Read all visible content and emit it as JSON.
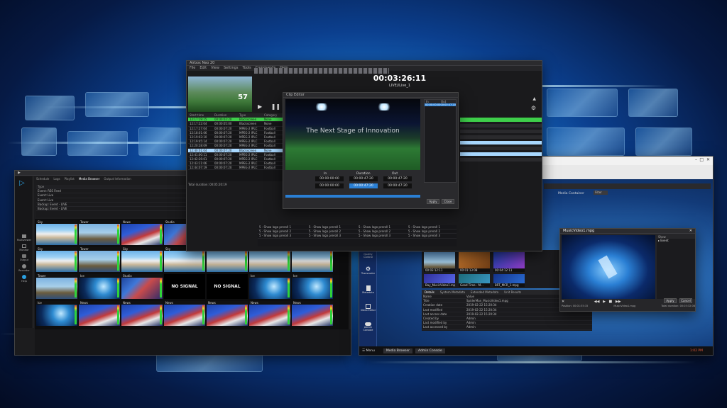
{
  "scheduler": {
    "title": "Airbox Neo 20",
    "menu": [
      "File",
      "Edit",
      "View",
      "Settings",
      "Tools",
      "Commands",
      "Help"
    ],
    "clock": "00:03:26:11",
    "channel": "LIVE//Live_1",
    "status_line": "Total duration: 00:05:20:19",
    "columns": [
      "Start time",
      "Duration",
      "Type",
      "Category"
    ],
    "rows": [
      [
        "12:17:19:15",
        "00:00:02:20",
        "Blackscreen",
        "None"
      ],
      [
        "12:17:22:04",
        "00:00:05:00",
        "Blackscreen",
        "None"
      ],
      [
        "12:17:27:04",
        "00:00:07:20",
        "MPEG-2 IPLC",
        "Football"
      ],
      [
        "12:18:01:06",
        "00:00:07:20",
        "MPEG-2 IPLC",
        "Football"
      ],
      [
        "12:19:03:10",
        "00:00:07:20",
        "MPEG-2 IPLC",
        "Football"
      ],
      [
        "12:19:45:14",
        "00:00:07:20",
        "MPEG-2 IPLC",
        "Football"
      ],
      [
        "12:20:28:09",
        "00:00:07:20",
        "MPEG-2 IPLC",
        "Football"
      ],
      [
        "12:40:01:04",
        "00:00:07:20",
        "Blackscreen",
        "None"
      ],
      [
        "12:41:00:11",
        "00:00:07:20",
        "MPEG-2 IPLC",
        "Football"
      ],
      [
        "12:42:26:01",
        "00:00:07:20",
        "MPEG-2 IPLC",
        "Football"
      ],
      [
        "12:43:11:06",
        "00:00:07:20",
        "MPEG-2 IPLC",
        "Football"
      ],
      [
        "12:44:07:19",
        "00:00:07:20",
        "MPEG-2 IPLC",
        "Football"
      ]
    ],
    "logo_rows": [
      [
        "5 - Show logo preroll 1",
        "5 - Show logo preroll 1",
        "5 - Show logo preroll 1",
        "5 - Show logo preroll 1"
      ],
      [
        "5 - Show logo preroll 2",
        "5 - Show logo preroll 2",
        "5 - Show logo preroll 2",
        "5 - Show logo preroll 2"
      ],
      [
        "5 - Show logo preroll 3",
        "5 - Show logo preroll 3",
        "5 - Show logo preroll 3",
        "5 - Show logo preroll 3"
      ]
    ]
  },
  "clip_editor": {
    "title": "Clip Editor",
    "overlay_text": "The Next Stage of Innovation",
    "tc_in": "00:00:00:00",
    "tc_duration": "00:00:47:20",
    "tc_out": "00:00:47:20",
    "tc_in2": "00:00:00:00",
    "tc_dur2": "00:00:47:20",
    "tc_out2": "00:00:47:20",
    "label_in": "In",
    "label_duration": "Duration",
    "label_out": "Out",
    "side_header_in": "In",
    "side_header_out": "Out",
    "side_in": "00:00:00:00",
    "side_out": "00:00:47:20",
    "apply": "Apply",
    "close": "Close"
  },
  "multiviewer": {
    "tabs": [
      "Schedule",
      "Logs",
      "Playlist",
      "Media Browser",
      "Output Information"
    ],
    "columns": [
      "Type",
      "Source"
    ],
    "rows": [
      [
        "Event: RSS Feed",
        "Start: 01:05:04:21"
      ],
      [
        "Event: Live",
        "Start: 01:05:04:21"
      ],
      [
        "Event: Live",
        "Start: 01:05:04:21"
      ],
      [
        "Backup: Event - LIVE",
        "Start: 01:05:04:21"
      ],
      [
        "Backup: Event - LIVE",
        "Start: 01:05:04:21"
      ]
    ],
    "nosignal_label": "NO SIGNAL",
    "tile_labels": [
      "Sky",
      "News",
      "Studio",
      "Ice",
      "Tower"
    ],
    "sidebar": [
      "Multiviewer",
      "Monitor",
      "Output",
      "Recorder",
      "Help"
    ]
  },
  "media": {
    "title": "Media Container",
    "filter": "Filter",
    "sidebar": [
      "Quality Control",
      "Transcoder",
      "Metadata",
      "Video Editor",
      "Admin Console"
    ],
    "clips": [
      "00:03:12:11",
      "00:01:13:08",
      "Bay_MusicVideo1.mpg",
      "Good Time - M...",
      "BRT_MCR_1.mpg",
      "00:04:12:11"
    ],
    "tabs": [
      "Details",
      "System Metadata",
      "Extended Metadata",
      "Unit Results"
    ],
    "meta": [
      [
        "Name",
        "Value"
      ],
      [
        "Title",
        "SpiderMan_MusicVideo1.mpg"
      ],
      [
        "Creation date",
        "2019-02-22 15:20:34"
      ],
      [
        "Last modified",
        "2019-02-22 15:20:34"
      ],
      [
        "Last access date",
        "2019-02-22 15:20:34"
      ],
      [
        "Created by",
        "Admin"
      ],
      [
        "Last modified by",
        "Admin"
      ],
      [
        "Last accessed by",
        "Admin"
      ]
    ],
    "taskbar": [
      "Menu",
      "Media Browser",
      "Admin Console"
    ],
    "taskbar_time": "1:02 PM"
  },
  "player": {
    "title": "MusicVideo1.mpg",
    "side_header": "Show",
    "side_item": "Event",
    "tc_left": "Position: 00:01:35:15",
    "tc_mid": "MusicVideo1.mpg",
    "tc_right": "Total duration: 00:03:32:08",
    "apply": "Apply",
    "cancel": "Cancel"
  },
  "colors": {
    "selected_row": "#3ecf4a",
    "highlight_row": "#a8d8ff",
    "accent": "#2a7fd4",
    "no_signal_bg": "#000000"
  }
}
